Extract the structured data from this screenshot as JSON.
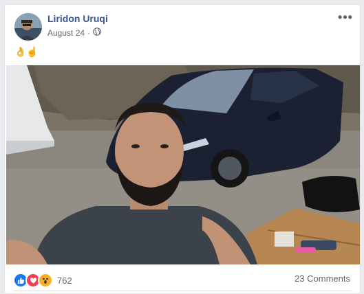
{
  "post": {
    "author": "Liridon Uruqi",
    "date": "August 24",
    "separator": "·",
    "text": "👌☝",
    "more_label": "•••",
    "reaction_count": "762",
    "comments_label": "23 Comments",
    "reaction_icons": [
      "like-icon",
      "love-icon",
      "wow-icon"
    ],
    "privacy_icon": "globe-icon"
  },
  "colors": {
    "author": "#385898",
    "like": "#1877f2",
    "love": "#f33e58",
    "wow": "#f7b125"
  }
}
